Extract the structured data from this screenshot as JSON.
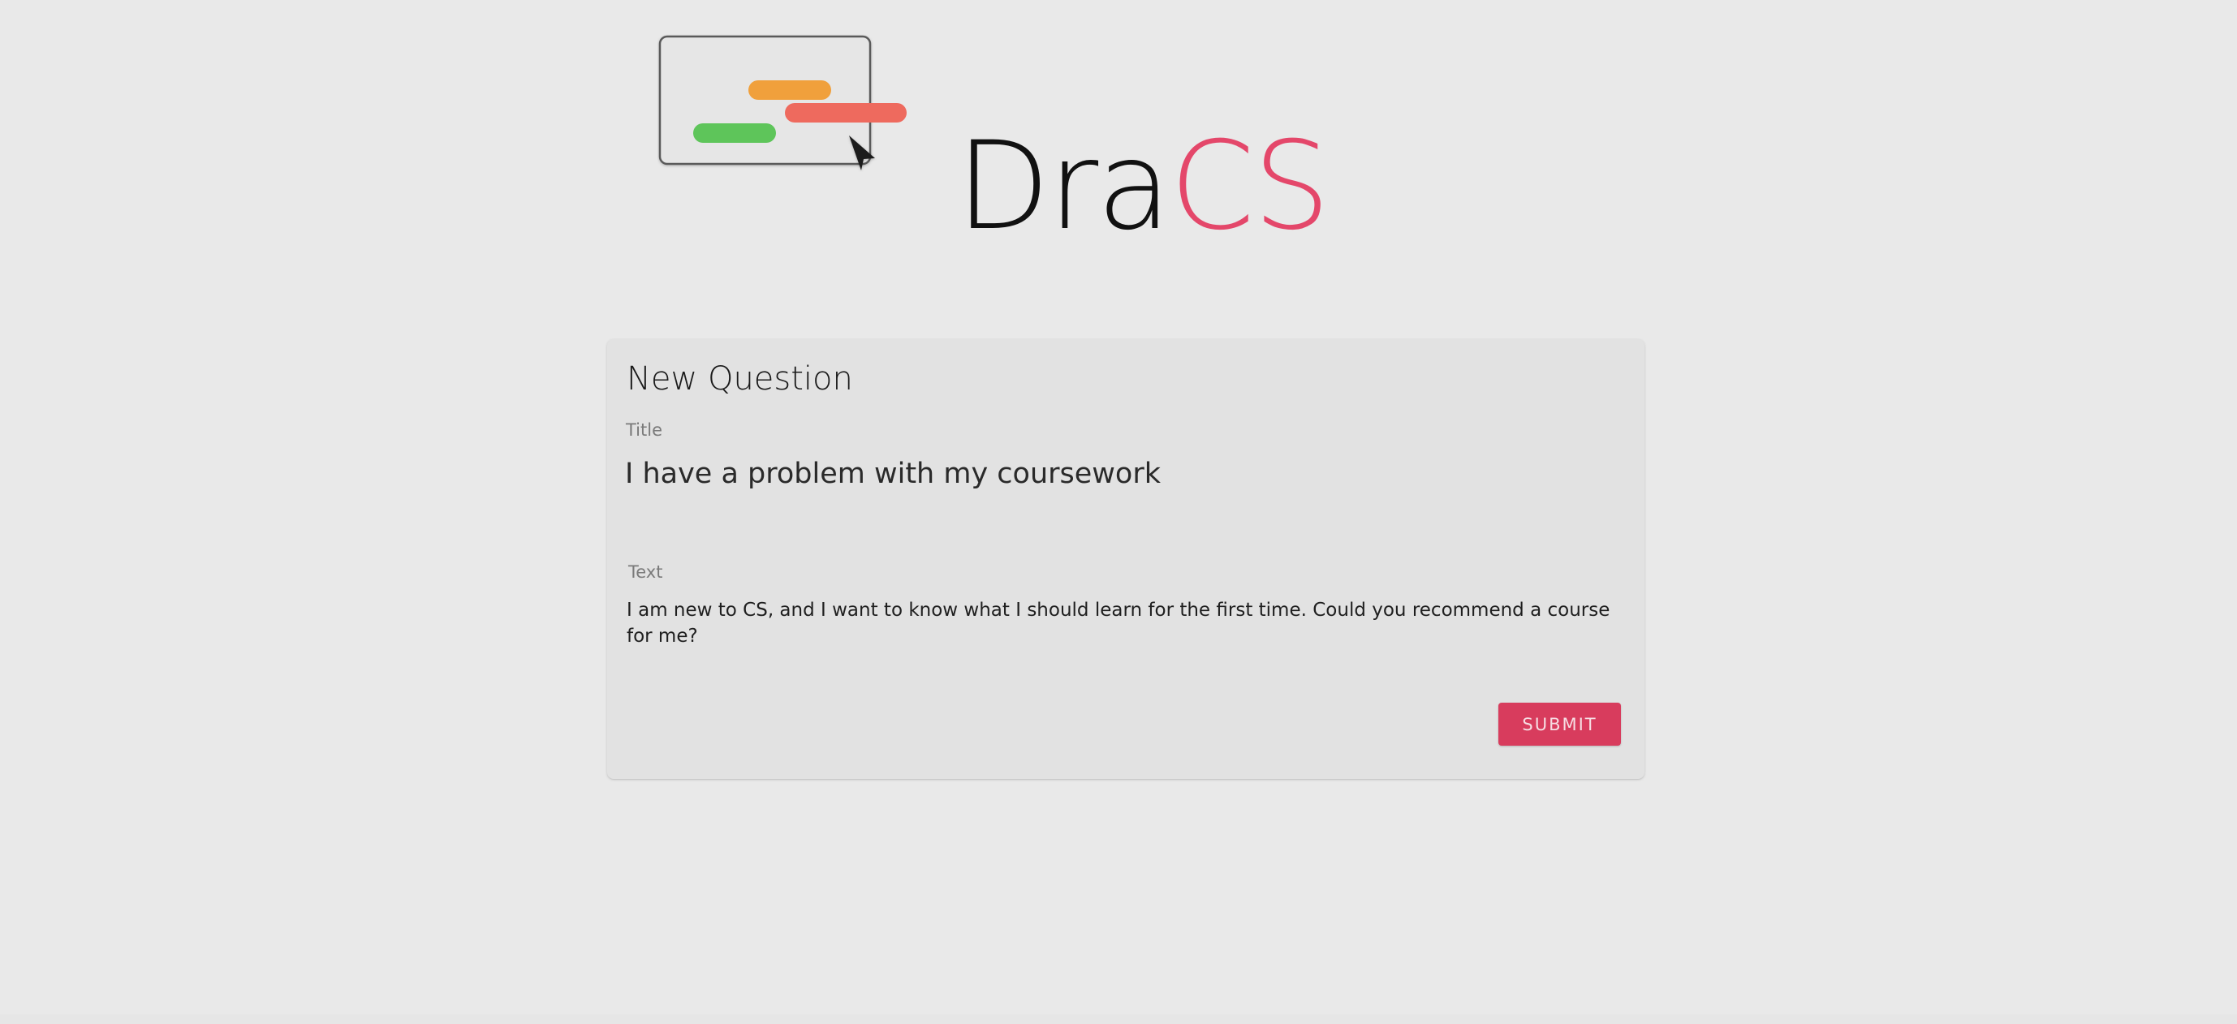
{
  "app": {
    "brand_part1": "Dra",
    "brand_part2": "CS"
  },
  "colors": {
    "background": "#e9e9e9",
    "card": "#e2e2e2",
    "accent": "#e4476a",
    "button": "#d83c5d",
    "logo_orange": "#f0a03c",
    "logo_red": "#ee6a5e",
    "logo_green": "#5ec55a"
  },
  "icons": {
    "logo": "dracs-logo-icon",
    "cursor": "cursor-arrow-icon"
  },
  "form": {
    "heading": "New Question",
    "title_label": "Title",
    "title_value": "I have a problem with my coursework",
    "text_label": "Text",
    "text_value": "I am new to CS, and I want to know what I should learn for the first time. Could you recommend a course for me?",
    "submit_label": "SUBMIT"
  }
}
